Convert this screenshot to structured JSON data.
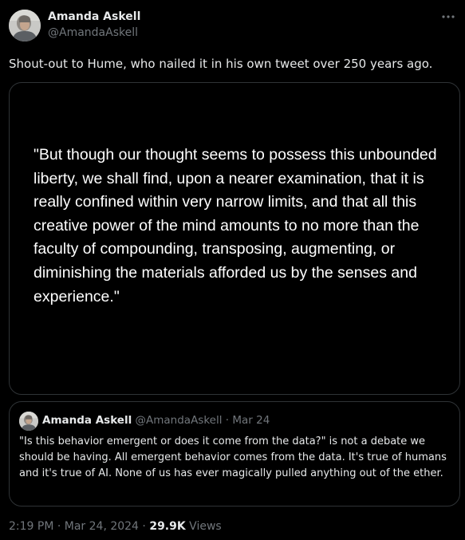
{
  "author": {
    "display_name": "Amanda Askell",
    "handle": "@AmandaAskell",
    "avatar": "profile-photo"
  },
  "more_icon": "more-horizontal-icon",
  "tweet": {
    "text": "Shout-out to Hume, who nailed it in his own tweet over 250 years ago."
  },
  "media": {
    "quote_text": "\"But though our thought seems to possess this unbounded liberty, we shall find, upon a nearer examination, that it is really confined within very narrow limits, and that all this creative power of the mind amounts to no more than the faculty of compounding, transposing, augmenting, or diminishing the materials afforded us by the senses and experience.\""
  },
  "quoted_tweet": {
    "display_name": "Amanda Askell",
    "handle": "@AmandaAskell",
    "separator": "·",
    "date": "Mar 24",
    "text": "\"Is this behavior emergent or does it come from the data?\" is not a debate we should be having. All emergent behavior comes from the data. It's true of humans and it's true of AI. None of us has ever magically pulled anything out of the ether."
  },
  "footer": {
    "timestamp": "2:19 PM · Mar 24, 2024 ·",
    "views_count": "29.9K",
    "views_label": "Views"
  },
  "colors": {
    "background": "#000000",
    "primary_text": "#e7e9ea",
    "secondary_text": "#71767b",
    "border": "#2f3336"
  }
}
